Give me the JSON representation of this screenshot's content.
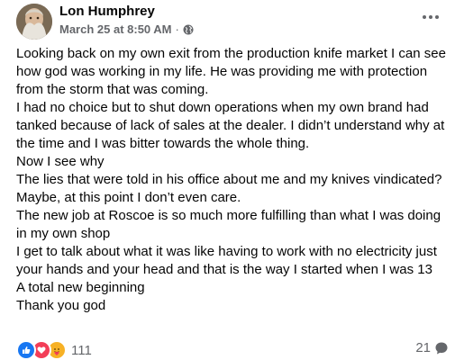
{
  "post": {
    "author": "Lon Humphrey",
    "timestamp": "March 25 at 8:50 AM",
    "separator": "·",
    "audience_icon": "globe-icon",
    "paragraphs": [
      "Looking back on my own exit from the production knife market I can see how god was working in my life. He was providing me with protection from the storm that was coming.",
      "I had no choice but to shut down operations when my own brand had tanked because of lack of sales at the dealer. I didn’t understand why at the time and I was bitter towards the whole thing.",
      "Now I see why",
      "The lies that were told in his office about me and my knives vindicated?",
      "Maybe, at this point I don’t even care.",
      "The new job at Roscoe is so much more fulfilling than what I was doing in my own shop",
      "I get to talk about what it was like having to work with no electricity just your hands and your head and that is the way I started when I was 13",
      "A total new beginning",
      "Thank you god"
    ]
  },
  "footer": {
    "reaction_icons": [
      "like-icon",
      "love-icon",
      "care-icon"
    ],
    "reaction_count": "111",
    "comment_count": "21",
    "comment_icon": "comment-icon"
  },
  "colors": {
    "text": "#050505",
    "secondary": "#65676b",
    "like": "#1877f2",
    "love": "#f33e58",
    "care": "#f7b125"
  }
}
